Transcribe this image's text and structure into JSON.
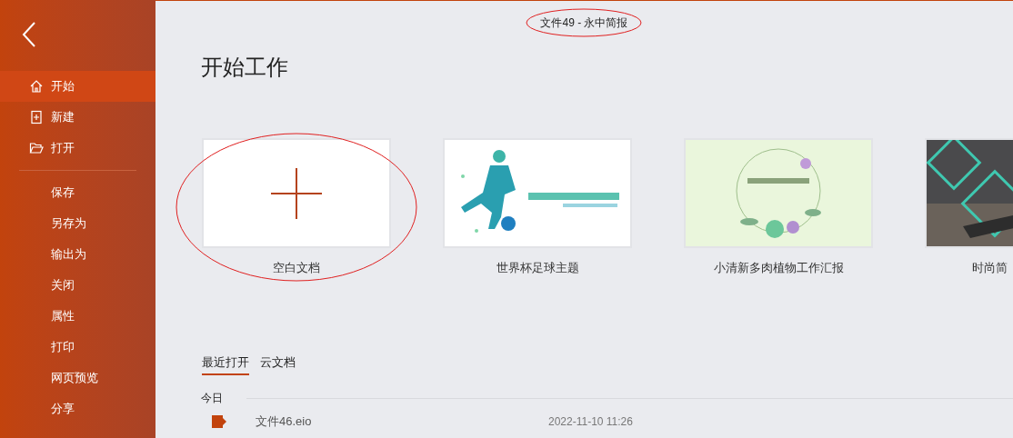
{
  "window": {
    "title": "文件49 - 永中简报",
    "annotated": true
  },
  "sidebar": {
    "items": [
      {
        "label": "开始",
        "kind": "home",
        "selected": true
      },
      {
        "label": "新建",
        "kind": "new",
        "selected": false
      },
      {
        "label": "打开",
        "kind": "open",
        "selected": false
      },
      {
        "label": "保存",
        "kind": "plain",
        "selected": false
      },
      {
        "label": "另存为",
        "kind": "plain",
        "selected": false
      },
      {
        "label": "输出为",
        "kind": "plain",
        "selected": false
      },
      {
        "label": "关闭",
        "kind": "plain",
        "selected": false
      },
      {
        "label": "属性",
        "kind": "plain",
        "selected": false
      },
      {
        "label": "打印",
        "kind": "plain",
        "selected": false
      },
      {
        "label": "网页预览",
        "kind": "plain",
        "selected": false
      },
      {
        "label": "分享",
        "kind": "plain",
        "selected": false
      }
    ]
  },
  "heading": "开始工作",
  "templates": [
    {
      "label": "空白文档",
      "kind": "blank",
      "annotated": true
    },
    {
      "label": "世界杯足球主题",
      "kind": "soccer",
      "annotated": false
    },
    {
      "label": "小清新多肉植物工作汇报",
      "kind": "floral",
      "annotated": false
    },
    {
      "label": "时尚简",
      "kind": "dark",
      "annotated": false
    }
  ],
  "tabs": [
    {
      "label": "最近打开",
      "selected": true
    },
    {
      "label": "云文档",
      "selected": false
    }
  ],
  "recent": {
    "group": "今日",
    "files": [
      {
        "name": "文件46.eio",
        "time": "2022-11-10 11:26"
      }
    ]
  }
}
